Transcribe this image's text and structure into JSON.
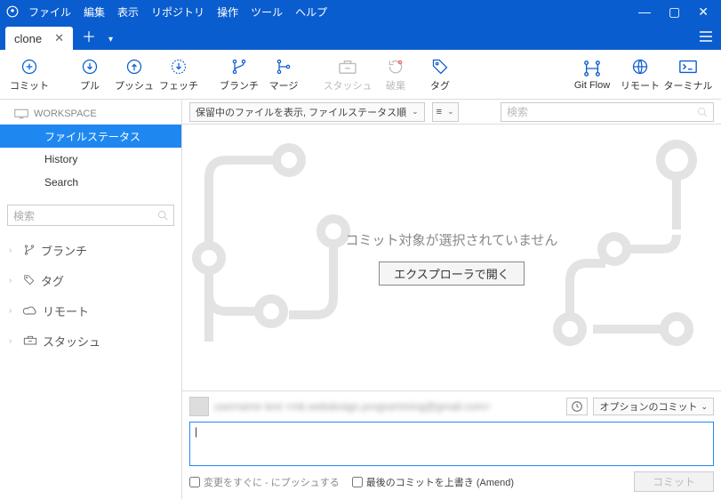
{
  "menu": {
    "file": "ファイル",
    "edit": "編集",
    "view": "表示",
    "repo": "リポジトリ",
    "action": "操作",
    "tools": "ツール",
    "help": "ヘルプ"
  },
  "tab": {
    "name": "clone"
  },
  "toolbar": {
    "commit": "コミット",
    "pull": "プル",
    "push": "プッシュ",
    "fetch": "フェッチ",
    "branch": "ブランチ",
    "merge": "マージ",
    "stash": "スタッシュ",
    "discard": "破棄",
    "tag": "タグ",
    "gitflow": "Git Flow",
    "remote": "リモート",
    "terminal": "ターミナル"
  },
  "sidebar": {
    "workspace_label": "WORKSPACE",
    "items": [
      "ファイルステータス",
      "History",
      "Search"
    ],
    "search_placeholder": "検索",
    "cats": {
      "branch": "ブランチ",
      "tag": "タグ",
      "remote": "リモート",
      "stash": "スタッシュ"
    }
  },
  "panel": {
    "filter_label": "保留中のファイルを表示, ファイルステータス順",
    "search_placeholder": "検索",
    "empty_msg": "コミット対象が選択されていません",
    "open_btn": "エクスプローラで開く"
  },
  "commit": {
    "author": "username test <mk.webdesign.programming@gmail.com>",
    "options": "オプションのコミット",
    "push_check": "変更をすぐに - にプッシュする",
    "amend_check": "最後のコミットを上書き (Amend)",
    "commit_btn": "コミット"
  }
}
